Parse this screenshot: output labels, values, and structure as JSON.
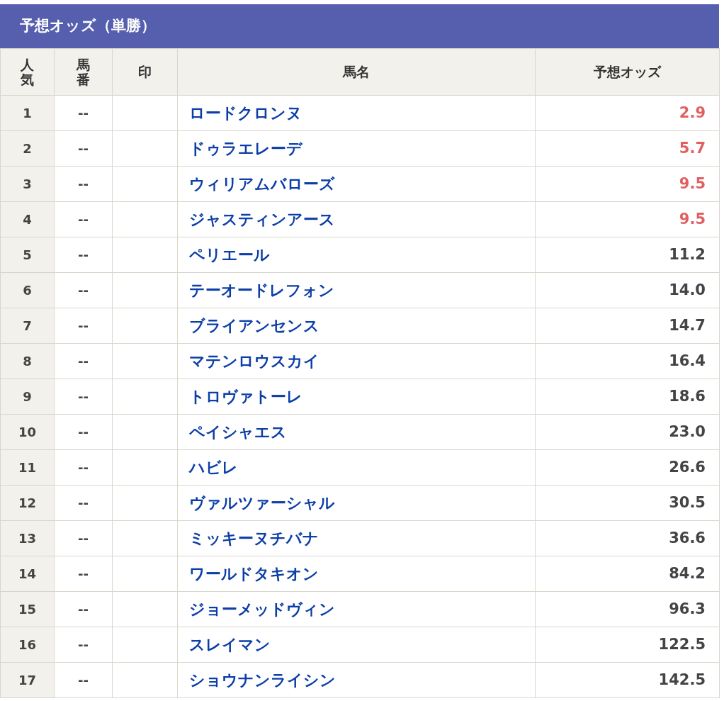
{
  "title": "予想オッズ（単勝）",
  "table": {
    "columns": [
      "人気",
      "馬番",
      "印",
      "馬名",
      "予想オッズ"
    ],
    "rows": [
      {
        "rank": "1",
        "number": "--",
        "name": "ロードクロンヌ",
        "odds": "2.9",
        "highlighted": true
      },
      {
        "rank": "2",
        "number": "--",
        "name": "ドゥラエレーデ",
        "odds": "5.7",
        "highlighted": true
      },
      {
        "rank": "3",
        "number": "--",
        "name": "ウィリアムバローズ",
        "odds": "9.5",
        "highlighted": true
      },
      {
        "rank": "4",
        "number": "--",
        "name": "ジャスティンアース",
        "odds": "9.5",
        "highlighted": true
      },
      {
        "rank": "5",
        "number": "--",
        "name": "ペリエール",
        "odds": "11.2",
        "highlighted": false
      },
      {
        "rank": "6",
        "number": "--",
        "name": "テーオードレフォン",
        "odds": "14.0",
        "highlighted": false
      },
      {
        "rank": "7",
        "number": "--",
        "name": "ブライアンセンス",
        "odds": "14.7",
        "highlighted": false
      },
      {
        "rank": "8",
        "number": "--",
        "name": "マテンロウスカイ",
        "odds": "16.4",
        "highlighted": false
      },
      {
        "rank": "9",
        "number": "--",
        "name": "トロヴァトーレ",
        "odds": "18.6",
        "highlighted": false
      },
      {
        "rank": "10",
        "number": "--",
        "name": "ペイシャエス",
        "odds": "23.0",
        "highlighted": false
      },
      {
        "rank": "11",
        "number": "--",
        "name": "ハビレ",
        "odds": "26.6",
        "highlighted": false
      },
      {
        "rank": "12",
        "number": "--",
        "name": "ヴァルツァーシャル",
        "odds": "30.5",
        "highlighted": false
      },
      {
        "rank": "13",
        "number": "--",
        "name": "ミッキーヌチバナ",
        "odds": "36.6",
        "highlighted": false
      },
      {
        "rank": "14",
        "number": "--",
        "name": "ワールドタキオン",
        "odds": "84.2",
        "highlighted": false
      },
      {
        "rank": "15",
        "number": "--",
        "name": "ジョーメッドヴィン",
        "odds": "96.3",
        "highlighted": false
      },
      {
        "rank": "16",
        "number": "--",
        "name": "スレイマン",
        "odds": "122.5",
        "highlighted": false
      },
      {
        "rank": "17",
        "number": "--",
        "name": "ショウナンライシン",
        "odds": "142.5",
        "highlighted": false
      }
    ]
  }
}
